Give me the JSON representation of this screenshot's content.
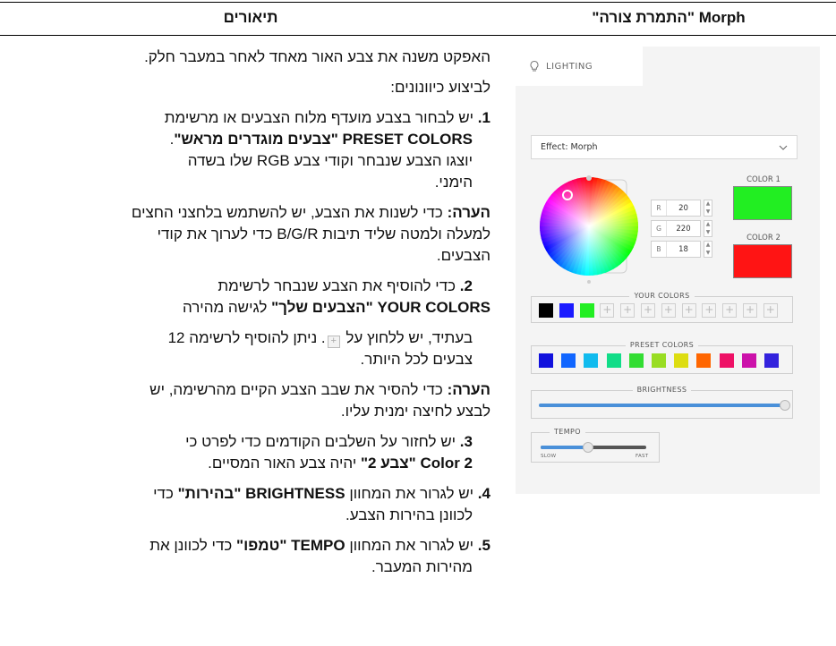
{
  "table": {
    "header_right": "Morph \"התמרת צורה\"",
    "header_left": "תיאורים"
  },
  "panel": {
    "tab_label": "LIGHTING",
    "effect_label": "Effect: Morph",
    "color1_label": "COLOR 1",
    "color2_label": "COLOR 2",
    "color1_hex": "#22ee22",
    "color2_hex": "#ff1414",
    "rgb": {
      "r_label": "R",
      "r_value": "20",
      "g_label": "G",
      "g_value": "220",
      "b_label": "B",
      "b_value": "18"
    },
    "your_colors_title": "YOUR COLORS",
    "your_colors": [
      "#000000",
      "#1a1aff",
      "#22ee22"
    ],
    "your_colors_empty_count": 9,
    "preset_colors_title": "PRESET COLORS",
    "preset_colors": [
      "#1111dd",
      "#1166ff",
      "#11bbee",
      "#11dd88",
      "#33dd33",
      "#99dd22",
      "#dddd11",
      "#ff6600",
      "#ee1166",
      "#cc11aa",
      "#3322dd"
    ],
    "brightness_title": "BRIGHTNESS",
    "brightness_level": 1.0,
    "tempo_title": "TEMPO",
    "tempo_slow": "SLOW",
    "tempo_fast": "FAST",
    "tempo_level": 0.45,
    "accent": "#4a90d9"
  },
  "text": {
    "intro": "האפקט משנה את צבע האור מאחד לאחר במעבר חלק.",
    "perform": "לביצוע כיוונונים:",
    "s1_num": "1.",
    "s1_a": "יש לבחור בצבע מועדף מלוח הצבעים או מרשימת",
    "s1_b": "PRESET COLORS \"צבעים מוגדרים מראש\"",
    "s1_b_end": ".",
    "s1_c": "יוצגו הצבע שנבחר וקודי צבע RGB שלו בשדה",
    "s1_d": "הימני.",
    "note_label": "הערה:",
    "note1_a": " כדי לשנות את הצבע, יש להשתמש בלחצני החצים",
    "note1_b": "למעלה ולמטה שליד תיבות B/G/R כדי לערוך את קודי",
    "note1_c": "הצבעים.",
    "s2_num": "2.",
    "s2_a": "כדי להוסיף את הצבע שנבחר לרשימת",
    "s2_b_bold": "YOUR COLORS \"הצבעים שלך\"",
    "s2_b_rest": " לגישה מהירה",
    "s2_c_1": "בעתיד, יש ללחוץ על",
    "s2_c_2": ". ניתן להוסיף לרשימה 12",
    "s2_d": "צבעים לכל היותר.",
    "note2_a": " כדי להסיר את שבב הצבע הקיים מהרשימה, יש",
    "note2_b": "לבצע לחיצה ימנית עליו.",
    "s3_num": "3.",
    "s3_a": "יש לחזור על השלבים הקודמים כדי לפרט כי",
    "s3_b_bold": "Color 2 \"צבע 2\"",
    "s3_b_rest": " יהיה צבע האור המסיים.",
    "s4_num": "4.",
    "s4_a_1": "יש לגרור את המחוון",
    "s4_a_bold": "BRIGHTNESS \"בהירות\"",
    "s4_a_2": " כדי",
    "s4_b": "לכוונן בהירות הצבע.",
    "s5_num": "5.",
    "s5_a_1": "יש לגרור את המחוון",
    "s5_a_bold": "TEMPO \"טמפו\"",
    "s5_a_2": " כדי לכוונן את",
    "s5_b": "מהירות המעבר."
  }
}
